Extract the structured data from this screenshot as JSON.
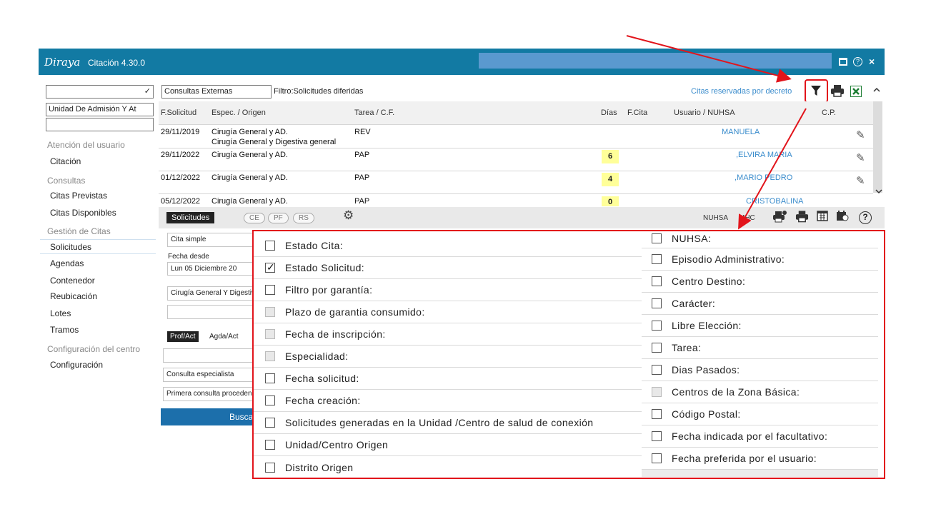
{
  "window": {
    "logo": "Diraya",
    "title": "Citación 4.30.0",
    "close_glyph": "×",
    "help_glyph": "?"
  },
  "sidebar": {
    "select1": "",
    "select2": "Unidad De Admisión Y At",
    "select3": "",
    "sections": [
      {
        "title": "Atención del usuario",
        "items": [
          "Citación"
        ]
      },
      {
        "title": "Consultas",
        "items": [
          "Citas Previstas",
          "Citas Disponibles"
        ]
      },
      {
        "title": "Gestión de Citas",
        "items": [
          "Solicitudes",
          "Agendas",
          "Contenedor",
          "Reubicación",
          "Lotes",
          "Tramos"
        ]
      },
      {
        "title": "Configuración del centro",
        "items": [
          "Configuración"
        ]
      }
    ]
  },
  "toolbar": {
    "tipo": "Consultas Externas",
    "filtro": "Filtro:Solicitudes diferidas",
    "citas_reservadas": "Citas reservadas por decreto"
  },
  "grid": {
    "headers": [
      "F.Solicitud",
      "Espec. / Origen",
      "Tarea / C.F.",
      "Días",
      "F.Cita",
      "Usuario / NUHSA",
      "C.P."
    ],
    "rows": [
      {
        "fecha": "29/11/2019",
        "espec": "Cirugía General y AD.",
        "espec2": "Cirugía General y Digestiva general",
        "tarea": "REV",
        "dias": "",
        "usuario": "MANUELA"
      },
      {
        "fecha": "29/11/2022",
        "espec": "Cirugía General y AD.",
        "espec2": "",
        "tarea": "PAP",
        "dias": "6",
        "usuario": ",ELVIRA MARIA"
      },
      {
        "fecha": "01/12/2022",
        "espec": "Cirugía General y AD.",
        "espec2": "",
        "tarea": "PAP",
        "dias": "4",
        "usuario": ",MARIO PEDRO"
      },
      {
        "fecha": "05/12/2022",
        "espec": "Cirugía General y AD.",
        "espec2": "",
        "tarea": "PAP",
        "dias": "0",
        "usuario": "CRISTOBALINA"
      }
    ]
  },
  "bottom": {
    "tab": "Solicitudes",
    "pills": [
      "CE",
      "PF",
      "RS"
    ],
    "nuhsa": "NUHSA",
    "mhc": "MHC"
  },
  "form": {
    "tipo_cita": "Cita simple",
    "fecha_label": "Fecha desde",
    "fecha_value": "Lun 05 Diciembre 20",
    "especialidad": "Cirugía General Y Digestiv",
    "tab1": "Prof/Act",
    "tab2": "Agda/Act",
    "consulta": "Consulta especialista",
    "primera": "Primera consulta proceden",
    "buscar": "Busca"
  },
  "filter_popup": {
    "left": [
      {
        "label": "Estado Cita:",
        "state": "off"
      },
      {
        "label": "Estado Solicitud:",
        "state": "on"
      },
      {
        "label": "Filtro por garantía:",
        "state": "off"
      },
      {
        "label": "Plazo de garantia consumido:",
        "state": "disabled"
      },
      {
        "label": "Fecha de inscripción:",
        "state": "disabled"
      },
      {
        "label": "Especialidad:",
        "state": "disabled"
      },
      {
        "label": "Fecha solicitud:",
        "state": "off"
      },
      {
        "label": "Fecha creación:",
        "state": "off"
      },
      {
        "label": "Solicitudes generadas en la Unidad /Centro de salud de conexión",
        "state": "off"
      },
      {
        "label": "Unidad/Centro Origen",
        "state": "off"
      },
      {
        "label": "Distrito Origen",
        "state": "off"
      }
    ],
    "right": [
      {
        "label": "NUHSA:",
        "state": "off"
      },
      {
        "label": "Episodio Administrativo:",
        "state": "off"
      },
      {
        "label": "Centro Destino:",
        "state": "off"
      },
      {
        "label": "Carácter:",
        "state": "off"
      },
      {
        "label": "Libre Elección:",
        "state": "off"
      },
      {
        "label": "Tarea:",
        "state": "off"
      },
      {
        "label": "Dias Pasados:",
        "state": "off"
      },
      {
        "label": "Centros de la Zona Básica:",
        "state": "disabled"
      },
      {
        "label": "Código Postal:",
        "state": "off"
      },
      {
        "label": "Fecha indicada por el facultativo:",
        "state": "off"
      },
      {
        "label": "Fecha preferida por el usuario:",
        "state": "off"
      }
    ]
  },
  "colors": {
    "titlebar": "#127aa3",
    "accent_blue": "#3a8ccc",
    "highlight_red": "#e2141b",
    "badge_yellow": "#ffff99"
  }
}
